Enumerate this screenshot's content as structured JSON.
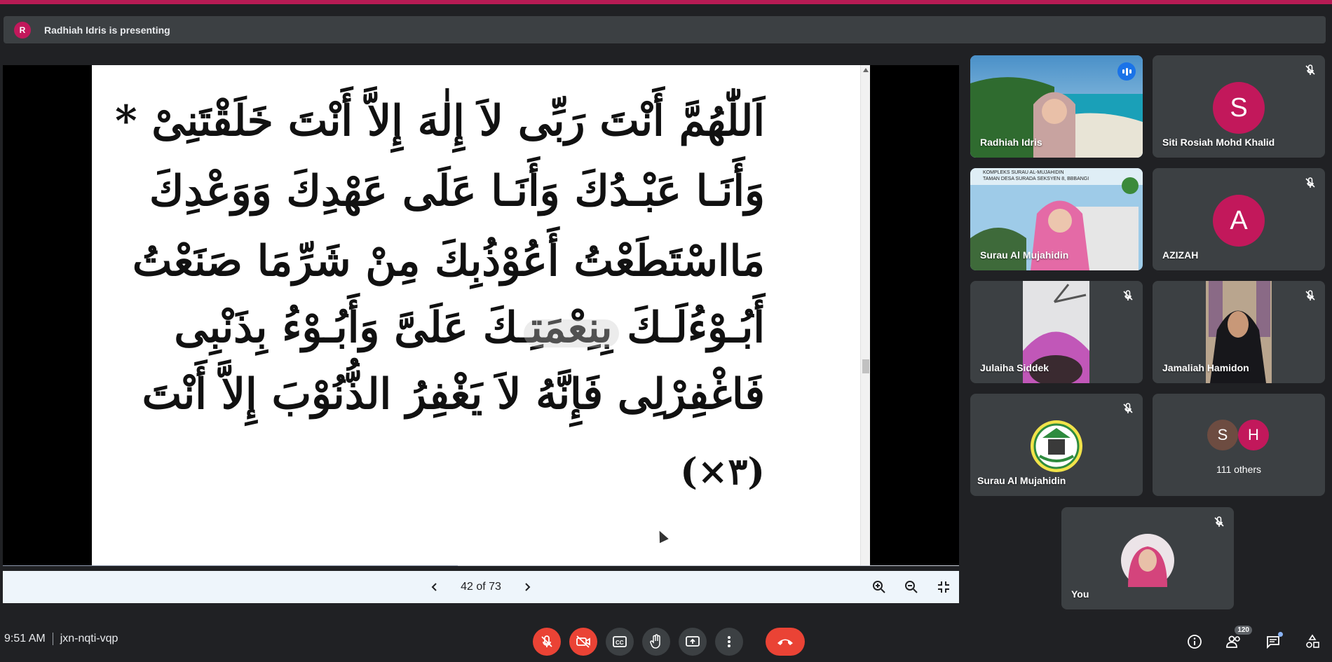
{
  "banner": {
    "avatar_letter": "R",
    "text": "Radhiah Idris is presenting"
  },
  "slide": {
    "lines": [
      "اَللّٰهُمَّ أَنْتَ رَبِّى لاَ إِلٰهَ إِلاَّ أَنْتَ خَلَقْتَنِىْ *",
      "وَأَنَـا عَبْـدُكَ وَأَنَـا عَلَى عَهْدِكَ وَوَعْدِكَ",
      "مَااسْتَطَعْتُ أَعُوْذُبِكَ مِنْ شَرِّمَا صَنَعْتُ",
      "أَبُـوْءُلَـكَ بِنِعْمَتِـكَ عَلَىَّ وَأَبُـوْءُ بِذَنْبِى",
      "فَاغْفِرْلِى فَإِنَّهُ لاَ يَغْفِرُ الذُّنُوْبَ إِلاَّ أَنْتَ",
      "(٣×)"
    ],
    "progress_fraction": 0.476
  },
  "pager": {
    "text": "42 of 73"
  },
  "participants": [
    {
      "name": "Radhiah Idris",
      "type": "video",
      "speaking": true
    },
    {
      "name": "Siti Rosiah Mohd Khalid",
      "type": "avatar",
      "letter": "S",
      "color": "#c2185b",
      "muted": true
    },
    {
      "name": "Surau Al Mujahidin",
      "type": "video",
      "overlay": "KOMPLEKS SURAU AL-MUJAHIDIN\nTAMAN DESA SURADA SEKSYEN 8, BBBANGI"
    },
    {
      "name": "AZIZAH",
      "type": "avatar",
      "letter": "A",
      "color": "#c2185b",
      "muted": true
    },
    {
      "name": "Julaiha Siddek",
      "type": "video",
      "muted": true
    },
    {
      "name": "Jamaliah Hamidon",
      "type": "video",
      "muted": true
    },
    {
      "name": "Surau Al Mujahidin",
      "type": "logo",
      "muted": true
    },
    {
      "name": "111 others",
      "type": "others",
      "letters": [
        "S",
        "H"
      ],
      "colors": [
        "#6d4c41",
        "#c2185b"
      ]
    },
    {
      "name": "You",
      "type": "photo",
      "muted": true
    }
  ],
  "meeting": {
    "time": "9:51 AM",
    "code": "jxn-nqti-vqp"
  },
  "people_count": "120",
  "colors": {
    "accent": "#b71b54",
    "danger": "#ea4335",
    "tile_bg": "#3c4043",
    "active": "#8ab4f8"
  }
}
